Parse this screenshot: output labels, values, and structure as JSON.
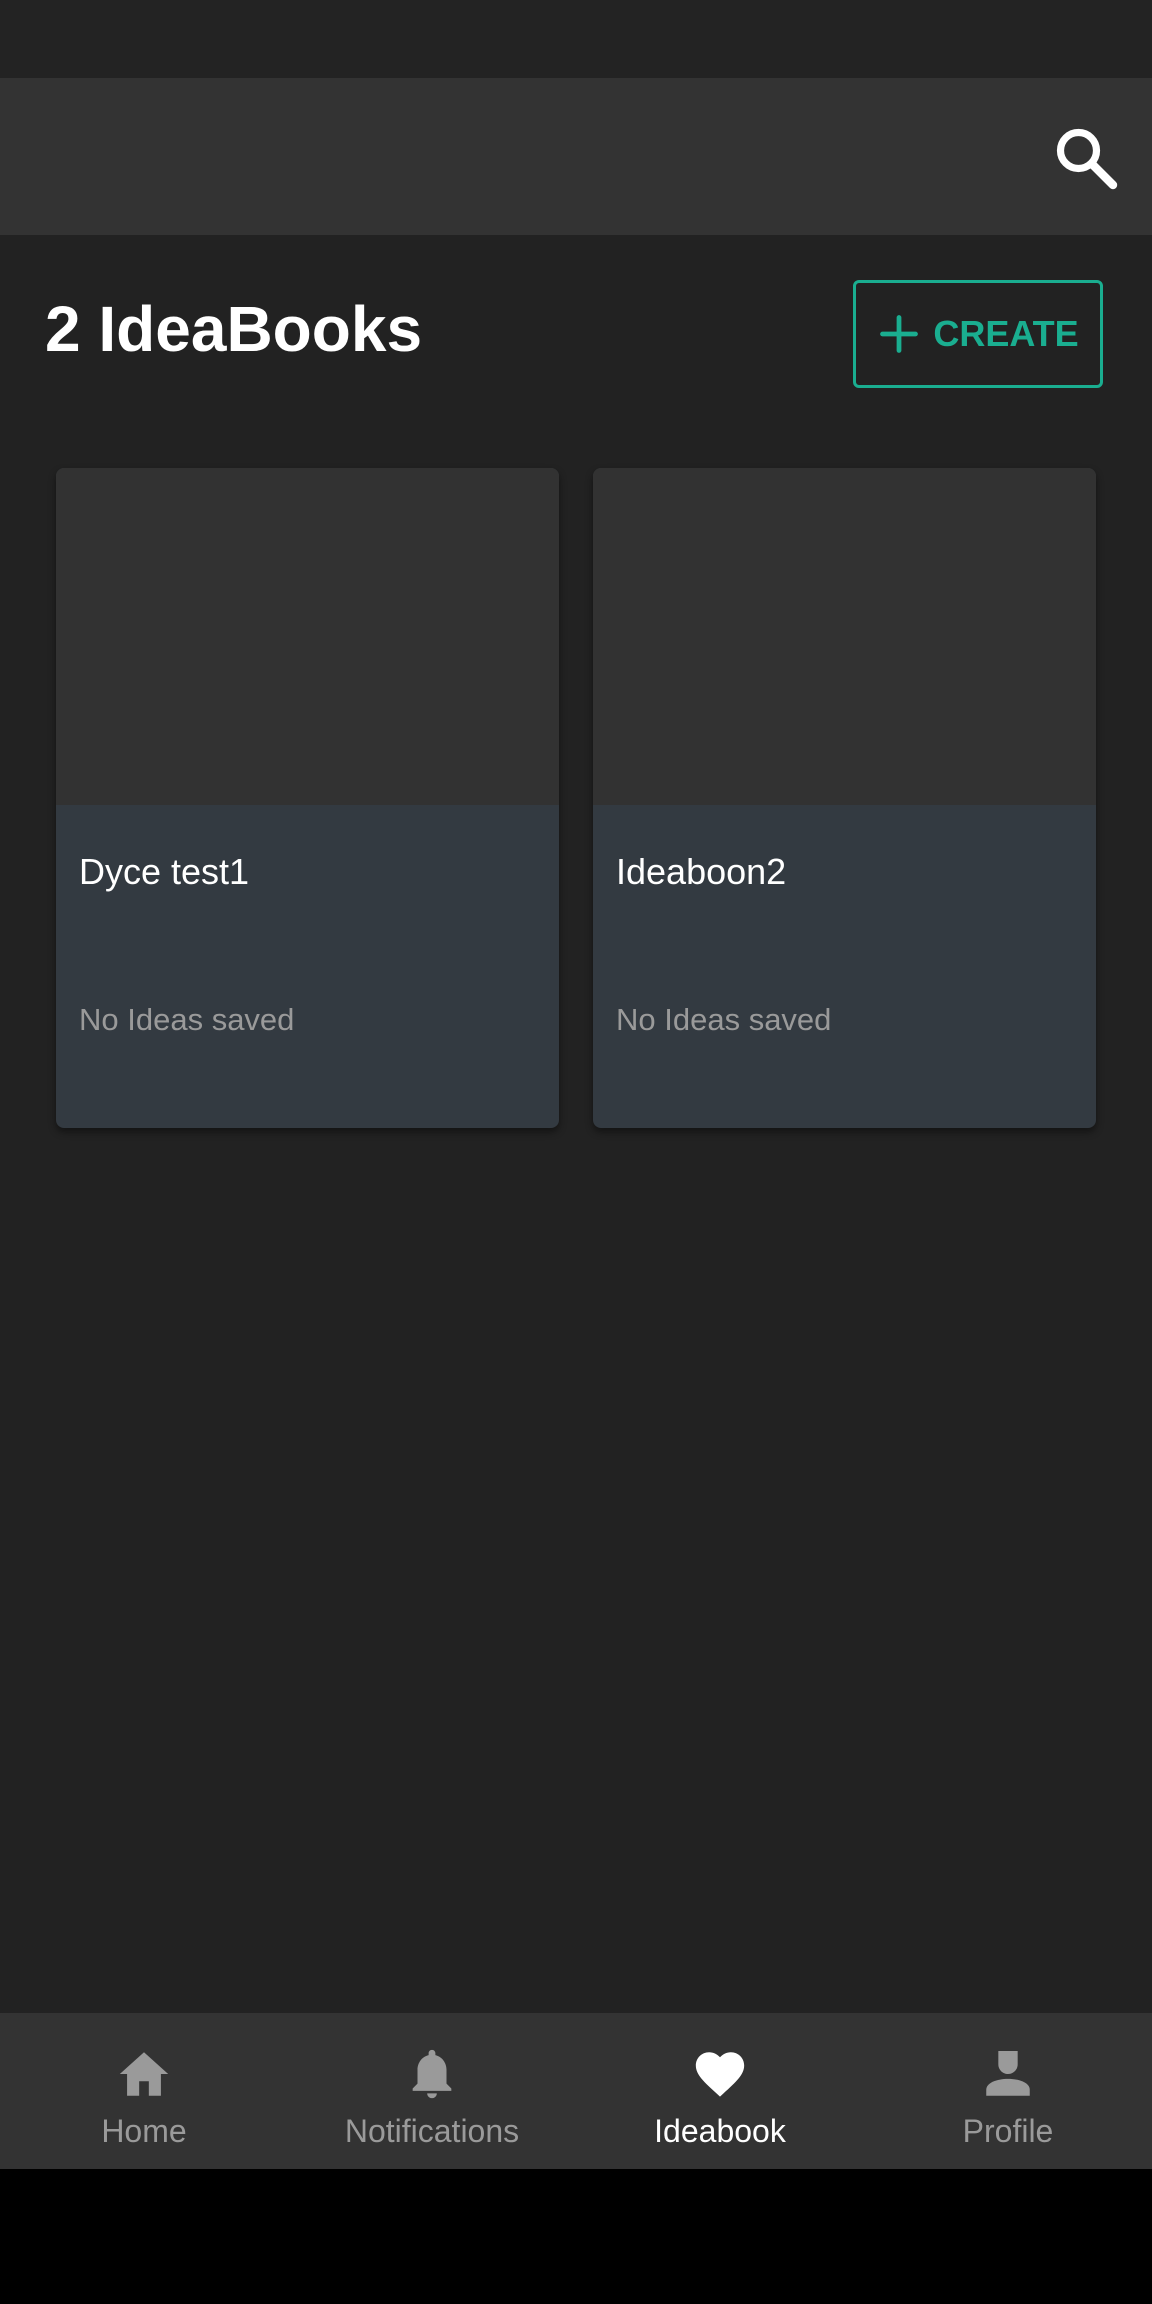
{
  "header": {
    "search_icon": "search-icon"
  },
  "page": {
    "title": "2 IdeaBooks",
    "create_label": "CREATE",
    "accent_color": "#1aae90"
  },
  "ideabooks": [
    {
      "title": "Dyce test1",
      "subtitle": "No Ideas saved"
    },
    {
      "title": "Ideaboon2",
      "subtitle": "No Ideas saved"
    }
  ],
  "bottom_nav": {
    "items": [
      {
        "label": "Home",
        "icon": "home-icon",
        "active": false
      },
      {
        "label": "Notifications",
        "icon": "bell-icon",
        "active": false
      },
      {
        "label": "Ideabook",
        "icon": "heart-icon",
        "active": true
      },
      {
        "label": "Profile",
        "icon": "person-icon",
        "active": false
      }
    ]
  }
}
